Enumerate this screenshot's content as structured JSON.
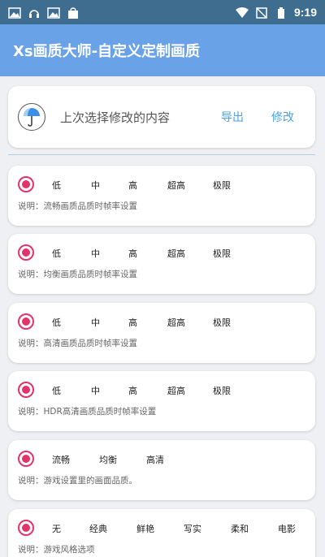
{
  "status_bar": {
    "time": "9:19",
    "left_icons": [
      "image-icon",
      "headset-icon",
      "image-icon",
      "bag-icon"
    ],
    "right_icons": [
      "wifi-icon",
      "no-sim-icon",
      "battery-icon"
    ]
  },
  "app_bar": {
    "title": "Xs画质大师-自定义定制画质"
  },
  "top_card": {
    "icon": "umbrella-icon",
    "label": "上次选择修改的内容",
    "export_label": "导出",
    "edit_label": "修改"
  },
  "options": [
    {
      "choices": [
        "低",
        "中",
        "高",
        "超高",
        "极限"
      ],
      "selected": 0,
      "description": "说明：流畅画质品质时帧率设置"
    },
    {
      "choices": [
        "低",
        "中",
        "高",
        "超高",
        "极限"
      ],
      "selected": 0,
      "description": "说明：均衡画质品质时帧率设置"
    },
    {
      "choices": [
        "低",
        "中",
        "高",
        "超高",
        "极限"
      ],
      "selected": 0,
      "description": "说明：高清画质品质时帧率设置"
    },
    {
      "choices": [
        "低",
        "中",
        "高",
        "超高",
        "极限"
      ],
      "selected": 0,
      "description": "说明：HDR高清画质品质时帧率设置"
    },
    {
      "choices": [
        "流畅",
        "均衡",
        "高清"
      ],
      "selected": 0,
      "description": "说明：游戏设置里的画面品质。"
    },
    {
      "choices": [
        "无",
        "经典",
        "鲜艳",
        "写实",
        "柔和",
        "电影"
      ],
      "selected": 0,
      "description": "说明：游戏风格选项"
    }
  ],
  "colors": {
    "status_bar": "#3f6d8f",
    "app_bar": "#6aa2e8",
    "accent_link": "#4aa0ea",
    "radio": "#e2336b"
  }
}
